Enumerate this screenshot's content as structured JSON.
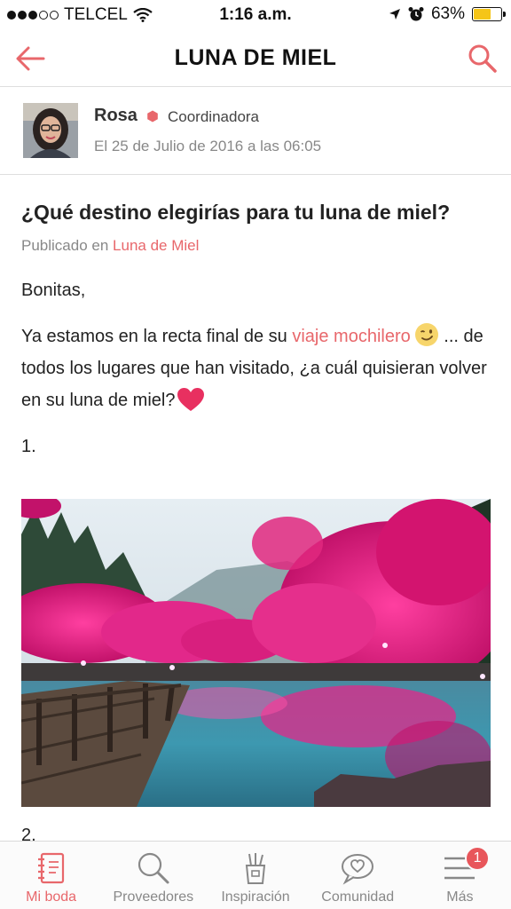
{
  "status_bar": {
    "carrier": "TELCEL",
    "time": "1:16 a.m.",
    "battery": "63%",
    "battery_level": 0.63
  },
  "nav": {
    "title": "LUNA DE MIEL",
    "back_icon": "arrow-left-icon",
    "search_icon": "search-icon"
  },
  "author": {
    "name": "Rosa",
    "role": "Coordinadora",
    "date": "El 25 de Julio de 2016 a las 06:05"
  },
  "post": {
    "title": "¿Qué destino elegirías para tu luna de miel?",
    "published_prefix": "Publicado en",
    "published_link": "Luna de Miel",
    "greeting": "Bonitas,",
    "body_before_link": "Ya estamos en la recta final de su ",
    "body_link": "viaje mochilero",
    "body_after_emoji": " ... de todos los lugares que han visitado, ¿a cuál quisieran volver en su luna de miel?",
    "item_1": "1.",
    "item_2": "2."
  },
  "tabs": [
    {
      "label": "Mi boda",
      "icon": "notebook-icon",
      "active": true
    },
    {
      "label": "Proveedores",
      "icon": "search-icon",
      "active": false
    },
    {
      "label": "Inspiración",
      "icon": "pencil-cup-icon",
      "active": false
    },
    {
      "label": "Comunidad",
      "icon": "chat-heart-icon",
      "active": false
    },
    {
      "label": "Más",
      "icon": "menu-icon",
      "active": false,
      "badge": "1"
    }
  ],
  "colors": {
    "accent": "#e8676b",
    "badge": "#e8565b",
    "battery": "#f5c518"
  }
}
